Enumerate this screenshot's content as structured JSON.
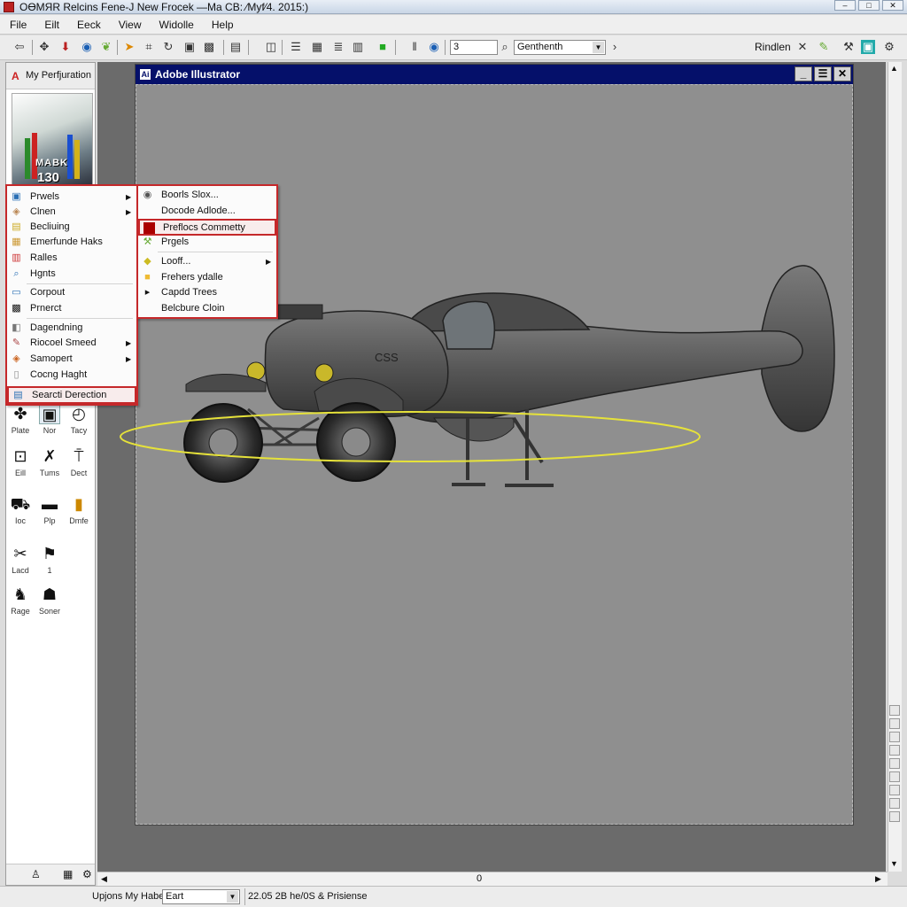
{
  "window": {
    "title": "ОӨMЯR Relcins Fene-J New Frocek —Ma CB: ⁄Myf⁄4. 2015:)"
  },
  "menubar": [
    "File",
    "Eilt",
    "Eeck",
    "View",
    "Widolle",
    "Help"
  ],
  "toolbar": {
    "size_value": "3",
    "font_value": "Genthenth",
    "right_label": "Rindlen"
  },
  "left_panel": {
    "title": "My Perfjuration",
    "thumbnail_text": "MABK",
    "thumbnail_number": "130",
    "tools": [
      {
        "label": "Plate",
        "icon": "puzzle-icon"
      },
      {
        "label": "Nor",
        "icon": "frame-icon"
      },
      {
        "label": "Tacy",
        "icon": "clock-icon"
      },
      {
        "label": "Eill",
        "icon": "square-icon"
      },
      {
        "label": "Tums",
        "icon": "cross-tools-icon"
      },
      {
        "label": "Dect",
        "icon": "pin-icon"
      },
      {
        "label": "Ioc",
        "icon": "car-icon"
      },
      {
        "label": "Plp",
        "icon": "black-rect-icon"
      },
      {
        "label": "Dmfe",
        "icon": "bottle-icon"
      },
      {
        "label": "Lacd",
        "icon": "scissors-icon"
      },
      {
        "label": "1",
        "icon": "runner-icon"
      },
      {
        "label": "Rage",
        "icon": "figure-icon"
      },
      {
        "label": "Soner",
        "icon": "gear-figure-icon"
      }
    ]
  },
  "context_menu_main": [
    {
      "label": "Prwels",
      "submenu": true,
      "icon": "image-icon"
    },
    {
      "label": "Clnen",
      "submenu": true,
      "icon": "palette-icon"
    },
    {
      "label": "Becliuing",
      "submenu": false,
      "icon": "chart-icon"
    },
    {
      "label": "Emerfunde Haks",
      "submenu": false,
      "icon": "gradient-icon"
    },
    {
      "label": "Ralles",
      "submenu": false,
      "icon": "bar-chart-icon"
    },
    {
      "label": "Hgnts",
      "submenu": false,
      "icon": "magnifier-icon"
    },
    {
      "label": "Corpout",
      "submenu": false,
      "icon": "monitor-icon"
    },
    {
      "label": "Prnerct",
      "submenu": false,
      "icon": "film-icon"
    },
    {
      "label": "Dagendning",
      "submenu": false,
      "icon": "layers-icon"
    },
    {
      "label": "Riocoel Smeed",
      "submenu": true,
      "icon": "brush-icon"
    },
    {
      "label": "Samopert",
      "submenu": true,
      "icon": "palette-icon"
    },
    {
      "label": "Cocng Haght",
      "submenu": false,
      "icon": "page-icon"
    },
    {
      "label": "Searcti Derection",
      "submenu": false,
      "icon": "search-doc-icon",
      "highlighted": true
    }
  ],
  "context_menu_sub": [
    {
      "label": "Boorls Slox...",
      "submenu": false,
      "icon": "globe-icon"
    },
    {
      "label": "Docode Adlode...",
      "submenu": false,
      "icon": ""
    },
    {
      "label": "Preflocs Commetty",
      "submenu": false,
      "icon": "red-square-icon",
      "highlighted": true
    },
    {
      "label": "Prgels",
      "submenu": false,
      "icon": "tools-icon"
    },
    {
      "label": "Looff...",
      "submenu": true,
      "icon": "diamond-icon"
    },
    {
      "label": "Frehers ydalle",
      "submenu": false,
      "icon": "yellow-square-icon"
    },
    {
      "label": "Capdd Trees",
      "submenu": false,
      "icon": "play-icon"
    },
    {
      "label": "Belcbure Cloin",
      "submenu": false,
      "icon": ""
    }
  ],
  "document": {
    "title": "Adobe Illustrator",
    "artwork_text": "CSS"
  },
  "hscroll": {
    "position_label": "0"
  },
  "statusbar": {
    "label": "Upjons My Habe",
    "field_value": "Eart",
    "info": "22.05 2B he/0S & Prisiense"
  },
  "colors": {
    "doc_title_bar": "#05106a",
    "highlight_border": "#c5282a",
    "artwork_ellipse": "#e6e23a"
  }
}
